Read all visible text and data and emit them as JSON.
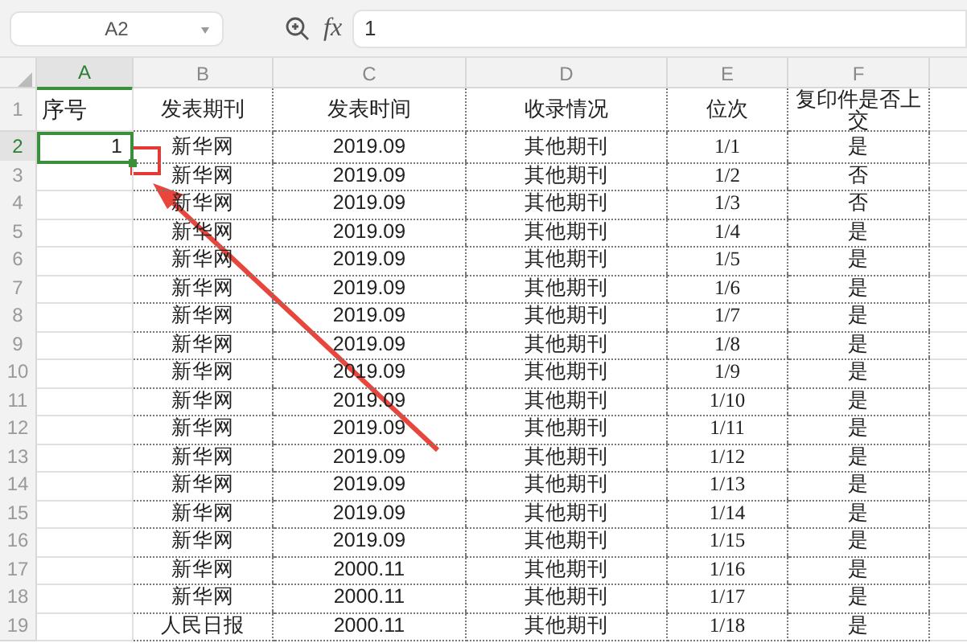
{
  "formula_bar": {
    "name_box": "A2",
    "fx_label": "fx",
    "value": "1"
  },
  "columns": [
    {
      "label": "A",
      "selected": true
    },
    {
      "label": "B",
      "selected": false
    },
    {
      "label": "C",
      "selected": false
    },
    {
      "label": "D",
      "selected": false
    },
    {
      "label": "E",
      "selected": false
    },
    {
      "label": "F",
      "selected": false
    }
  ],
  "rows": [
    {
      "number": "1",
      "selected": false,
      "A": "序号",
      "B": "发表期刊",
      "C": "发表时间",
      "D": "收录情况",
      "E": "位次",
      "F": "复印件是否上交"
    },
    {
      "number": "2",
      "selected": true,
      "A": "1",
      "B": "新华网",
      "C": "2019.09",
      "D": "其他期刊",
      "E": "1/1",
      "F": "是"
    },
    {
      "number": "3",
      "selected": false,
      "B": "新华网",
      "C": "2019.09",
      "D": "其他期刊",
      "E": "1/2",
      "F": "否"
    },
    {
      "number": "4",
      "selected": false,
      "B": "新华网",
      "C": "2019.09",
      "D": "其他期刊",
      "E": "1/3",
      "F": "否"
    },
    {
      "number": "5",
      "selected": false,
      "B": "新华网",
      "C": "2019.09",
      "D": "其他期刊",
      "E": "1/4",
      "F": "是"
    },
    {
      "number": "6",
      "selected": false,
      "B": "新华网",
      "C": "2019.09",
      "D": "其他期刊",
      "E": "1/5",
      "F": "是"
    },
    {
      "number": "7",
      "selected": false,
      "B": "新华网",
      "C": "2019.09",
      "D": "其他期刊",
      "E": "1/6",
      "F": "是"
    },
    {
      "number": "8",
      "selected": false,
      "B": "新华网",
      "C": "2019.09",
      "D": "其他期刊",
      "E": "1/7",
      "F": "是"
    },
    {
      "number": "9",
      "selected": false,
      "B": "新华网",
      "C": "2019.09",
      "D": "其他期刊",
      "E": "1/8",
      "F": "是"
    },
    {
      "number": "10",
      "selected": false,
      "B": "新华网",
      "C": "2019.09",
      "D": "其他期刊",
      "E": "1/9",
      "F": "是"
    },
    {
      "number": "11",
      "selected": false,
      "B": "新华网",
      "C": "2019.09",
      "D": "其他期刊",
      "E": "1/10",
      "F": "是"
    },
    {
      "number": "12",
      "selected": false,
      "B": "新华网",
      "C": "2019.09",
      "D": "其他期刊",
      "E": "1/11",
      "F": "是"
    },
    {
      "number": "13",
      "selected": false,
      "B": "新华网",
      "C": "2019.09",
      "D": "其他期刊",
      "E": "1/12",
      "F": "是"
    },
    {
      "number": "14",
      "selected": false,
      "B": "新华网",
      "C": "2019.09",
      "D": "其他期刊",
      "E": "1/13",
      "F": "是"
    },
    {
      "number": "15",
      "selected": false,
      "B": "新华网",
      "C": "2019.09",
      "D": "其他期刊",
      "E": "1/14",
      "F": "是"
    },
    {
      "number": "16",
      "selected": false,
      "B": "新华网",
      "C": "2019.09",
      "D": "其他期刊",
      "E": "1/15",
      "F": "是"
    },
    {
      "number": "17",
      "selected": false,
      "B": "新华网",
      "C": "2000.11",
      "D": "其他期刊",
      "E": "1/16",
      "F": "是"
    },
    {
      "number": "18",
      "selected": false,
      "B": "新华网",
      "C": "2000.11",
      "D": "其他期刊",
      "E": "1/17",
      "F": "是"
    },
    {
      "number": "19",
      "selected": false,
      "B": "人民日报",
      "C": "2000.11",
      "D": "其他期刊",
      "E": "1/18",
      "F": "是"
    }
  ]
}
